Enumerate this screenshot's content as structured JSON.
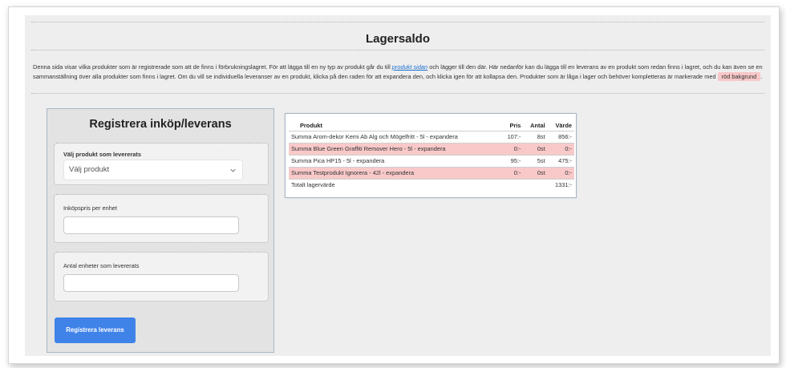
{
  "page": {
    "title": "Lagersaldo",
    "intro": {
      "part1": "Denna sida visar vilka produkter som är registrerade som att de finns i förbrukningslagret. För att lägga till en ny typ av produkt går du till",
      "link": "produkt sidan",
      "part2": "och lägger till den där. Här nedanför kan du lägga till en leverans av en produkt som redan finns i lagret, och du kan även se en sammanställning över alla produkter som finns i lagret. Om du vill se individuella leveranser av en produkt, klicka på den raden för att expandera den, och klicka igen för att kollapsa den. Produkter som är låga i lager och behöver kompletteras är markerade med",
      "highlight": "röd bakgrund",
      "part3": "."
    }
  },
  "register": {
    "title": "Registrera inköp/leverans",
    "product_label": "Välj produkt som levererats",
    "product_select_value": "Välj produkt",
    "price_label": "Inköpspris per enhet",
    "price_value": "",
    "quantity_label": "Antal enheter som levererats",
    "quantity_value": "",
    "submit_label": "Registrera leverans"
  },
  "inventory": {
    "headers": {
      "product": "Produkt",
      "price": "Pris",
      "quantity": "Antal",
      "value": "Värde"
    },
    "rows": [
      {
        "product": "Summa Arom-dekor Kemi Ab Alg och Mögelfritt - 5l - expandera",
        "price": "107:-",
        "quantity": "8st",
        "value": "856:-",
        "low": false
      },
      {
        "product": "Summa Blue Green Graffiti Remover Hero - 5l - expandera",
        "price": "0:-",
        "quantity": "0st",
        "value": "0:-",
        "low": true
      },
      {
        "product": "Summa Pica HP15 - 5l - expandera",
        "price": "95:-",
        "quantity": "5st",
        "value": "475:-",
        "low": false
      },
      {
        "product": "Summa Testprodukt Ignorera - 42l - expandera",
        "price": "0:-",
        "quantity": "0st",
        "value": "0:-",
        "low": true
      }
    ],
    "total_label": "Totalt lagervärde",
    "total_value": "1331:-"
  },
  "colors": {
    "low_stock_bg": "#f9c9c9",
    "primary_button": "#3f82e8",
    "link": "#1a6fd0"
  }
}
